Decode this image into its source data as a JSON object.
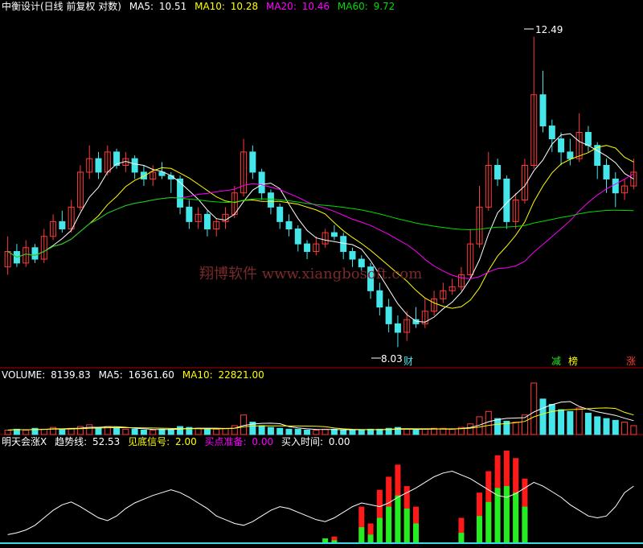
{
  "colors": {
    "background": "#000000",
    "up": "#ff3b3b",
    "down": "#44e6ea",
    "ma5": "#ffffff",
    "ma10": "#ffff00",
    "ma20": "#ff00ff",
    "ma60": "#00dd00",
    "divider": "#b00000",
    "signal_red": "#ff1a1a",
    "signal_green": "#22ee22",
    "signal_cyan": "#33dddd",
    "trend": "#ffffff",
    "marker": "#ff44ff"
  },
  "panels": {
    "price": {
      "title": "中衡设计(日线 前复权 对数)",
      "legend": [
        {
          "label": "MA5:",
          "value": "10.51",
          "color": "#ffffff"
        },
        {
          "label": "MA10:",
          "value": "10.28",
          "color": "#ffff00"
        },
        {
          "label": "MA20:",
          "value": "10.46",
          "color": "#ff00ff"
        },
        {
          "label": "MA60:",
          "value": "9.72",
          "color": "#00dd00"
        }
      ],
      "high_label": "12.49",
      "low_label": "8.03",
      "watermark": "翔博软件 www.xiangbosoft.com",
      "event_tags": [
        "财",
        "减",
        "榜",
        "涨"
      ]
    },
    "volume": {
      "legend": [
        {
          "label": "VOLUME:",
          "value": "8139.83",
          "color": "#ffffff"
        },
        {
          "label": "MA5:",
          "value": "16361.60",
          "color": "#ffffff"
        },
        {
          "label": "MA10:",
          "value": "22821.00",
          "color": "#ffff00"
        }
      ]
    },
    "indicator": {
      "name": "明天会涨X",
      "legend": [
        {
          "label": "趋势线:",
          "value": "52.53",
          "color": "#ffffff"
        },
        {
          "label": "见底信号:",
          "value": "2.00",
          "color": "#ffff00"
        },
        {
          "label": "买点准备:",
          "value": "0.00",
          "color": "#ff00ff"
        },
        {
          "label": "买入时间:",
          "value": "0.00",
          "color": "#ffffff"
        }
      ]
    }
  },
  "chart_data": {
    "type": "candlestick",
    "scale": "log",
    "price_high": 12.49,
    "price_low": 8.03,
    "candles": [
      [
        9.0,
        9.2,
        9.4,
        8.9
      ],
      [
        9.2,
        9.05,
        9.3,
        9.0
      ],
      [
        9.05,
        9.25,
        9.35,
        9.0
      ],
      [
        9.25,
        9.1,
        9.3,
        9.05
      ],
      [
        9.1,
        9.4,
        9.5,
        9.05
      ],
      [
        9.4,
        9.6,
        9.7,
        9.35
      ],
      [
        9.6,
        9.5,
        9.75,
        9.45
      ],
      [
        9.5,
        9.8,
        9.9,
        9.45
      ],
      [
        9.8,
        10.3,
        10.4,
        9.75
      ],
      [
        10.3,
        10.5,
        10.7,
        10.2
      ],
      [
        10.5,
        10.3,
        10.6,
        10.2
      ],
      [
        10.3,
        10.6,
        10.7,
        10.25
      ],
      [
        10.6,
        10.4,
        10.65,
        10.35
      ],
      [
        10.4,
        10.5,
        10.6,
        10.3
      ],
      [
        10.5,
        10.3,
        10.55,
        10.2
      ],
      [
        10.3,
        10.2,
        10.4,
        10.1
      ],
      [
        10.2,
        10.3,
        10.4,
        10.1
      ],
      [
        10.3,
        10.25,
        10.45,
        10.2
      ],
      [
        10.25,
        10.2,
        10.3,
        10.0
      ],
      [
        10.2,
        9.8,
        10.25,
        9.7
      ],
      [
        9.8,
        9.6,
        9.9,
        9.5
      ],
      [
        9.6,
        9.7,
        9.8,
        9.5
      ],
      [
        9.7,
        9.5,
        9.75,
        9.4
      ],
      [
        9.5,
        9.6,
        9.65,
        9.4
      ],
      [
        9.6,
        9.7,
        9.8,
        9.5
      ],
      [
        9.7,
        10.0,
        10.1,
        9.65
      ],
      [
        10.0,
        10.6,
        10.8,
        9.95
      ],
      [
        10.6,
        10.3,
        10.7,
        10.2
      ],
      [
        10.3,
        10.0,
        10.35,
        9.9
      ],
      [
        10.0,
        9.8,
        10.05,
        9.7
      ],
      [
        9.8,
        9.6,
        9.85,
        9.5
      ],
      [
        9.6,
        9.5,
        9.7,
        9.4
      ],
      [
        9.5,
        9.3,
        9.55,
        9.2
      ],
      [
        9.3,
        9.2,
        9.35,
        9.1
      ],
      [
        9.2,
        9.3,
        9.4,
        9.15
      ],
      [
        9.3,
        9.45,
        9.5,
        9.25
      ],
      [
        9.45,
        9.4,
        9.55,
        9.35
      ],
      [
        9.4,
        9.2,
        9.45,
        9.1
      ],
      [
        9.2,
        9.1,
        9.25,
        9.0
      ],
      [
        9.1,
        9.0,
        9.15,
        8.95
      ],
      [
        9.0,
        8.7,
        9.05,
        8.6
      ],
      [
        8.7,
        8.5,
        8.8,
        8.4
      ],
      [
        8.5,
        8.3,
        8.6,
        8.2
      ],
      [
        8.3,
        8.2,
        8.4,
        8.03
      ],
      [
        8.2,
        8.35,
        8.45,
        8.1
      ],
      [
        8.35,
        8.3,
        8.5,
        8.25
      ],
      [
        8.3,
        8.45,
        8.6,
        8.25
      ],
      [
        8.45,
        8.6,
        8.7,
        8.4
      ],
      [
        8.6,
        8.7,
        8.8,
        8.55
      ],
      [
        8.7,
        8.75,
        8.85,
        8.65
      ],
      [
        8.75,
        8.9,
        9.0,
        8.7
      ],
      [
        8.9,
        9.3,
        9.5,
        8.85
      ],
      [
        9.3,
        9.8,
        10.1,
        9.25
      ],
      [
        9.8,
        10.4,
        10.6,
        9.75
      ],
      [
        10.4,
        10.2,
        10.5,
        10.1
      ],
      [
        10.2,
        9.6,
        10.25,
        9.5
      ],
      [
        9.6,
        9.9,
        10.0,
        9.5
      ],
      [
        9.9,
        10.4,
        10.5,
        9.85
      ],
      [
        10.4,
        11.5,
        12.49,
        10.35
      ],
      [
        11.5,
        11.0,
        11.9,
        10.9
      ],
      [
        11.0,
        10.8,
        11.1,
        10.6
      ],
      [
        10.8,
        10.6,
        10.9,
        10.4
      ],
      [
        10.6,
        10.5,
        10.8,
        10.4
      ],
      [
        10.5,
        10.9,
        11.2,
        10.45
      ],
      [
        10.9,
        10.7,
        11.0,
        10.6
      ],
      [
        10.7,
        10.4,
        10.75,
        10.2
      ],
      [
        10.4,
        10.2,
        10.5,
        10.0
      ],
      [
        10.2,
        10.0,
        10.3,
        9.8
      ],
      [
        10.0,
        10.1,
        10.2,
        9.9
      ],
      [
        10.1,
        10.3,
        10.5,
        10.05
      ]
    ],
    "volume": [
      5,
      6,
      5,
      7,
      6,
      8,
      6,
      7,
      9,
      11,
      8,
      9,
      7,
      6,
      6,
      5,
      5,
      6,
      6,
      9,
      8,
      7,
      6,
      6,
      7,
      10,
      22,
      14,
      10,
      8,
      7,
      6,
      6,
      5,
      5,
      6,
      6,
      5,
      5,
      5,
      6,
      6,
      7,
      8,
      6,
      5,
      6,
      7,
      7,
      6,
      8,
      12,
      20,
      26,
      18,
      15,
      14,
      22,
      58,
      40,
      34,
      28,
      26,
      30,
      24,
      20,
      18,
      16,
      14,
      10
    ],
    "trend_line": [
      10,
      12,
      15,
      20,
      28,
      36,
      42,
      45,
      40,
      34,
      28,
      25,
      30,
      38,
      44,
      48,
      52,
      55,
      58,
      55,
      50,
      44,
      38,
      30,
      26,
      22,
      20,
      24,
      30,
      36,
      40,
      38,
      34,
      30,
      26,
      24,
      28,
      34,
      40,
      44,
      42,
      40,
      44,
      50,
      55,
      60,
      66,
      72,
      76,
      78,
      74,
      70,
      64,
      58,
      52,
      50,
      54,
      60,
      66,
      62,
      56,
      50,
      42,
      36,
      30,
      28,
      30,
      40,
      55,
      62
    ],
    "signal_bars": [
      {
        "i": 35,
        "red": 0,
        "green": 6
      },
      {
        "i": 36,
        "red": 8,
        "green": 4
      },
      {
        "i": 39,
        "red": 40,
        "green": 18
      },
      {
        "i": 40,
        "red": 22,
        "green": 10
      },
      {
        "i": 41,
        "red": 58,
        "green": 28
      },
      {
        "i": 42,
        "red": 72,
        "green": 40
      },
      {
        "i": 43,
        "red": 85,
        "green": 52
      },
      {
        "i": 44,
        "red": 62,
        "green": 38
      },
      {
        "i": 45,
        "red": 40,
        "green": 22
      },
      {
        "i": 50,
        "red": 28,
        "green": 12
      },
      {
        "i": 52,
        "red": 55,
        "green": 30
      },
      {
        "i": 53,
        "red": 78,
        "green": 45
      },
      {
        "i": 54,
        "red": 95,
        "green": 60
      },
      {
        "i": 55,
        "red": 100,
        "green": 62
      },
      {
        "i": 56,
        "red": 92,
        "green": 55
      },
      {
        "i": 57,
        "red": 70,
        "green": 40
      }
    ]
  }
}
